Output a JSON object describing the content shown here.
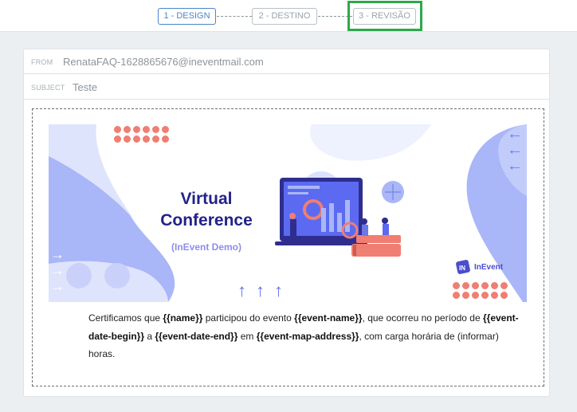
{
  "steps": [
    {
      "label": "1 - DESIGN"
    },
    {
      "label": "2 - DESTINO"
    },
    {
      "label": "3 - REVISÃO"
    }
  ],
  "email": {
    "from_label": "FROM",
    "from_value": "RenataFAQ-1628865676@ineventmail.com",
    "subject_label": "SUBJECT",
    "subject_value": "Teste"
  },
  "banner": {
    "title_line1": "Virtual",
    "title_line2": "Conference",
    "subtitle": "(InEvent Demo)",
    "logo_text": "InEvent",
    "logo_mark": "IN"
  },
  "body": {
    "t1": "Certificamos que ",
    "v_name": "{{name}}",
    "t2": " participou do evento ",
    "v_event": "{{event-name}}",
    "t3": ", que ocorreu no período de ",
    "v_begin": "{{event-date-begin}}",
    "t4": " a ",
    "v_end": "{{event-date-end}}",
    "t5": " em ",
    "v_addr": "{{event-map-address}}",
    "t6": ", com carga horária de (informar) horas."
  },
  "colors": {
    "accent": "#4a86c8",
    "highlight": "#2ea84a",
    "brand_dark": "#23228a",
    "brand_light": "#8b8df0",
    "dots": "#f07e72",
    "blob": "#a9b6f7"
  }
}
